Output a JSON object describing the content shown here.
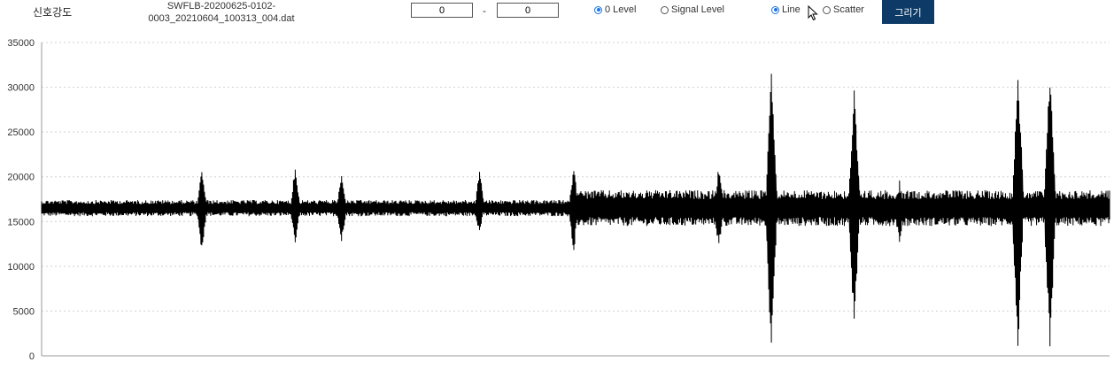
{
  "toolbar": {
    "page_label": "신호강도",
    "file_name": "SWFLB-20200625-0102-0003_20210604_100313_004.dat",
    "range_start": "0",
    "range_separator": "-",
    "range_end": "0",
    "level_options": [
      {
        "label": "0 Level",
        "checked": true
      },
      {
        "label": "Signal Level",
        "checked": false
      }
    ],
    "type_options": [
      {
        "label": "Line",
        "checked": true
      },
      {
        "label": "Scatter",
        "checked": false
      }
    ],
    "draw_button_label": "그리기",
    "icons": {
      "cursor": "mouse-pointer-icon"
    }
  },
  "chart_data": {
    "type": "line",
    "title": "",
    "xlabel": "",
    "ylabel": "",
    "ylim": [
      0,
      35000
    ],
    "y_ticks": [
      "0",
      "5000",
      "10000",
      "15000",
      "20000",
      "25000",
      "30000",
      "35000"
    ],
    "grid": "horizontal dotted",
    "series_color": "#000000",
    "baseline": 16500,
    "x_range": [
      0,
      1200
    ],
    "bursts": [
      {
        "x": 180,
        "low": 11500,
        "high": 21000
      },
      {
        "x": 285,
        "low": 12000,
        "high": 21300
      },
      {
        "x": 337,
        "low": 12500,
        "high": 20500
      },
      {
        "x": 492,
        "low": 13500,
        "high": 21000
      },
      {
        "x": 598,
        "low": 11000,
        "high": 21500
      },
      {
        "x": 761,
        "low": 11500,
        "high": 21500
      },
      {
        "x": 820,
        "low": 0,
        "high": 33000
      },
      {
        "x": 913,
        "low": 3000,
        "high": 30000
      },
      {
        "x": 964,
        "low": 12000,
        "high": 20000
      },
      {
        "x": 1097,
        "low": 0,
        "high": 33000
      },
      {
        "x": 1133,
        "low": 0,
        "high": 33000
      }
    ]
  }
}
